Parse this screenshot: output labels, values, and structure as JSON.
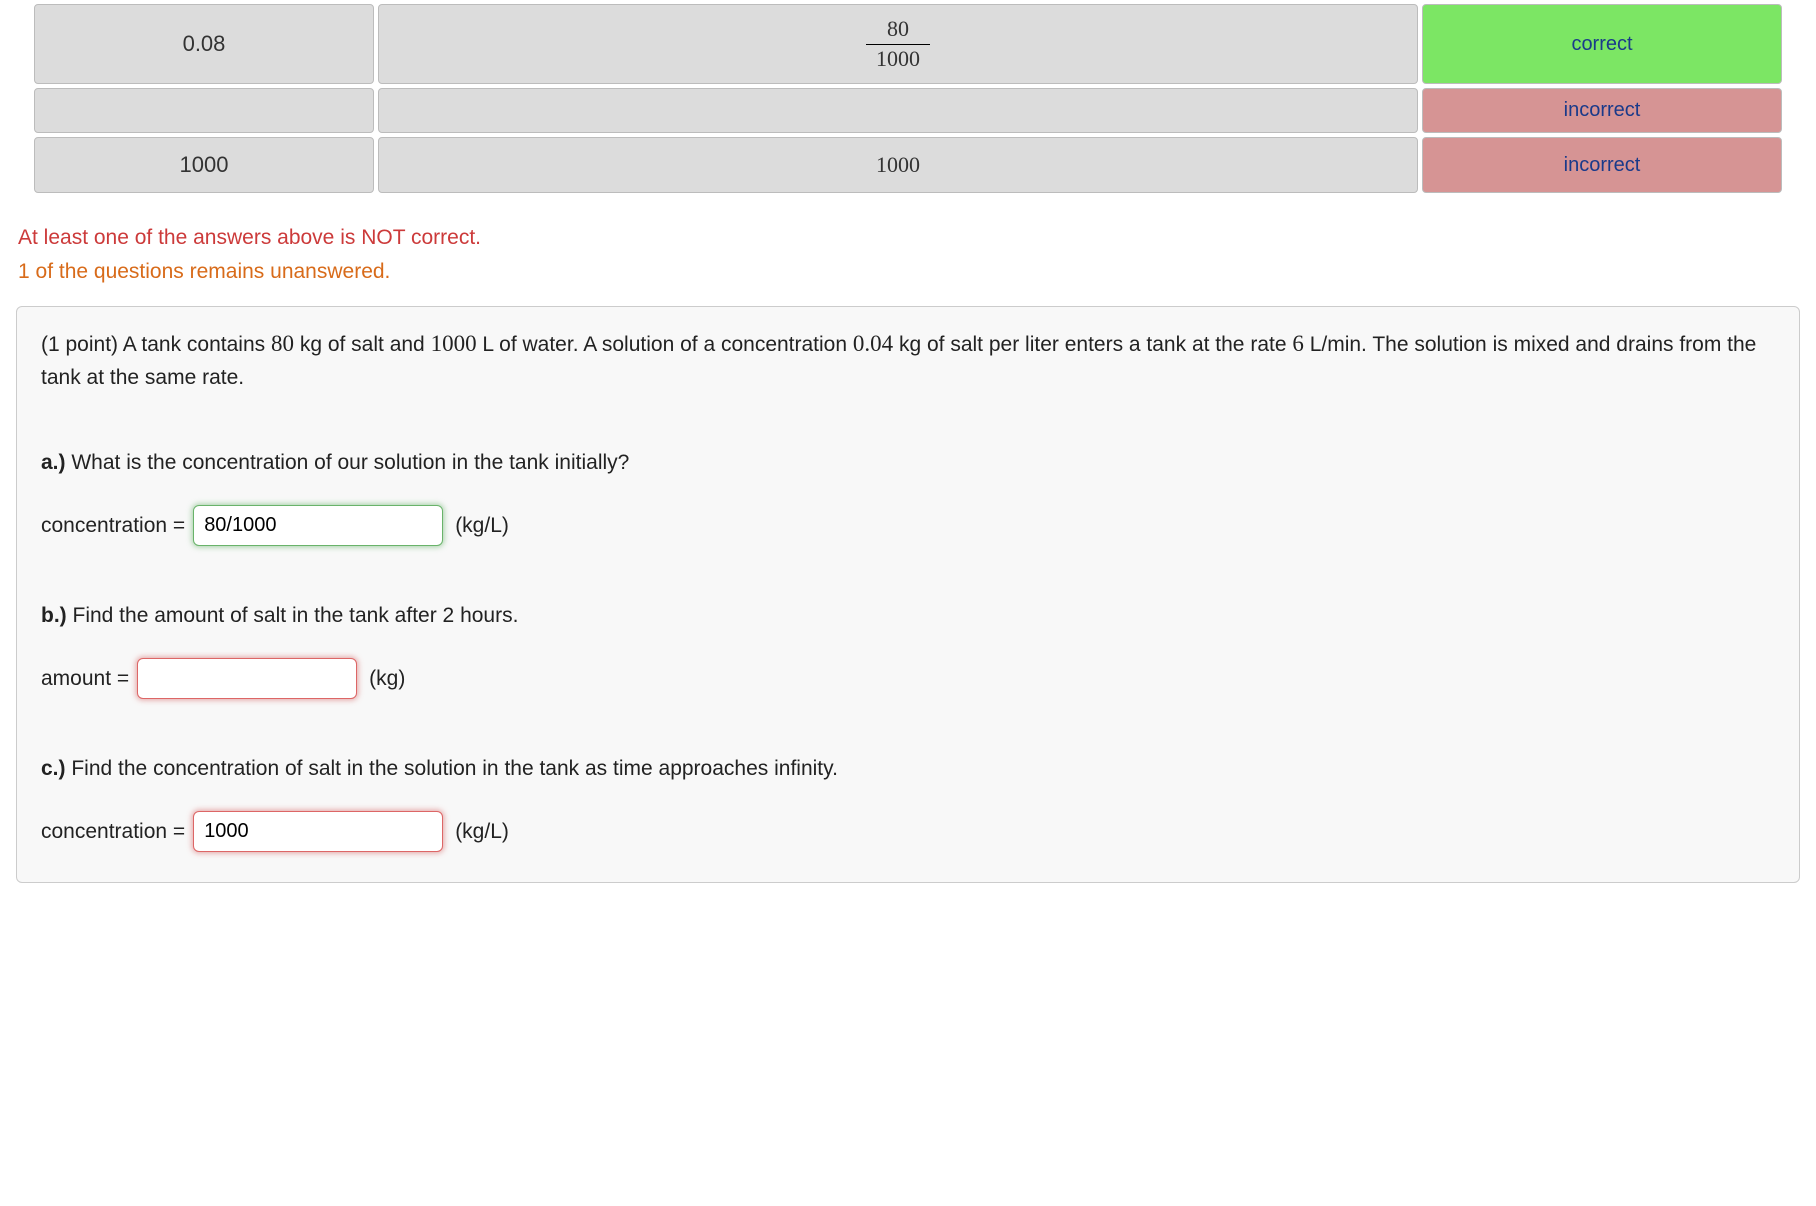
{
  "results_table": {
    "rows": [
      {
        "entered": "0.08",
        "preview_frac": {
          "num": "80",
          "den": "1000"
        },
        "status": "correct",
        "status_class": "correct"
      },
      {
        "entered": "",
        "preview": "",
        "status": "incorrect",
        "status_class": "incorrect",
        "short": true
      },
      {
        "entered": "1000",
        "preview": "1000",
        "status": "incorrect",
        "status_class": "incorrect"
      }
    ]
  },
  "messages": {
    "error": "At least one of the answers above is NOT correct.",
    "warning": "1 of the questions remains unanswered."
  },
  "problem": {
    "points_label": "(1 point)",
    "text_parts": [
      " A tank contains ",
      "80",
      " kg of salt and ",
      "1000",
      " L of water. A solution of a concentration ",
      "0.04",
      " kg of salt per liter enters a tank at the rate ",
      "6",
      " L/min. The solution is mixed and drains from the tank at the same rate."
    ],
    "parts": {
      "a": {
        "label": "a.)",
        "question": " What is the concentration of our solution in the tank initially?",
        "field_label": "concentration =",
        "value": "80/1000",
        "unit": "(kg/L)",
        "state": "ok"
      },
      "b": {
        "label": "b.)",
        "question_pre": " Find the amount of salt in the tank after ",
        "question_num": "2",
        "question_post": " hours.",
        "field_label": "amount =",
        "value": "",
        "unit": "(kg)",
        "state": "bad-empty"
      },
      "c": {
        "label": "c.)",
        "question": " Find the concentration of salt in the solution in the tank as time approaches infinity.",
        "field_label": "concentration =",
        "value": "1000",
        "unit": "(kg/L)",
        "state": "bad"
      }
    }
  }
}
